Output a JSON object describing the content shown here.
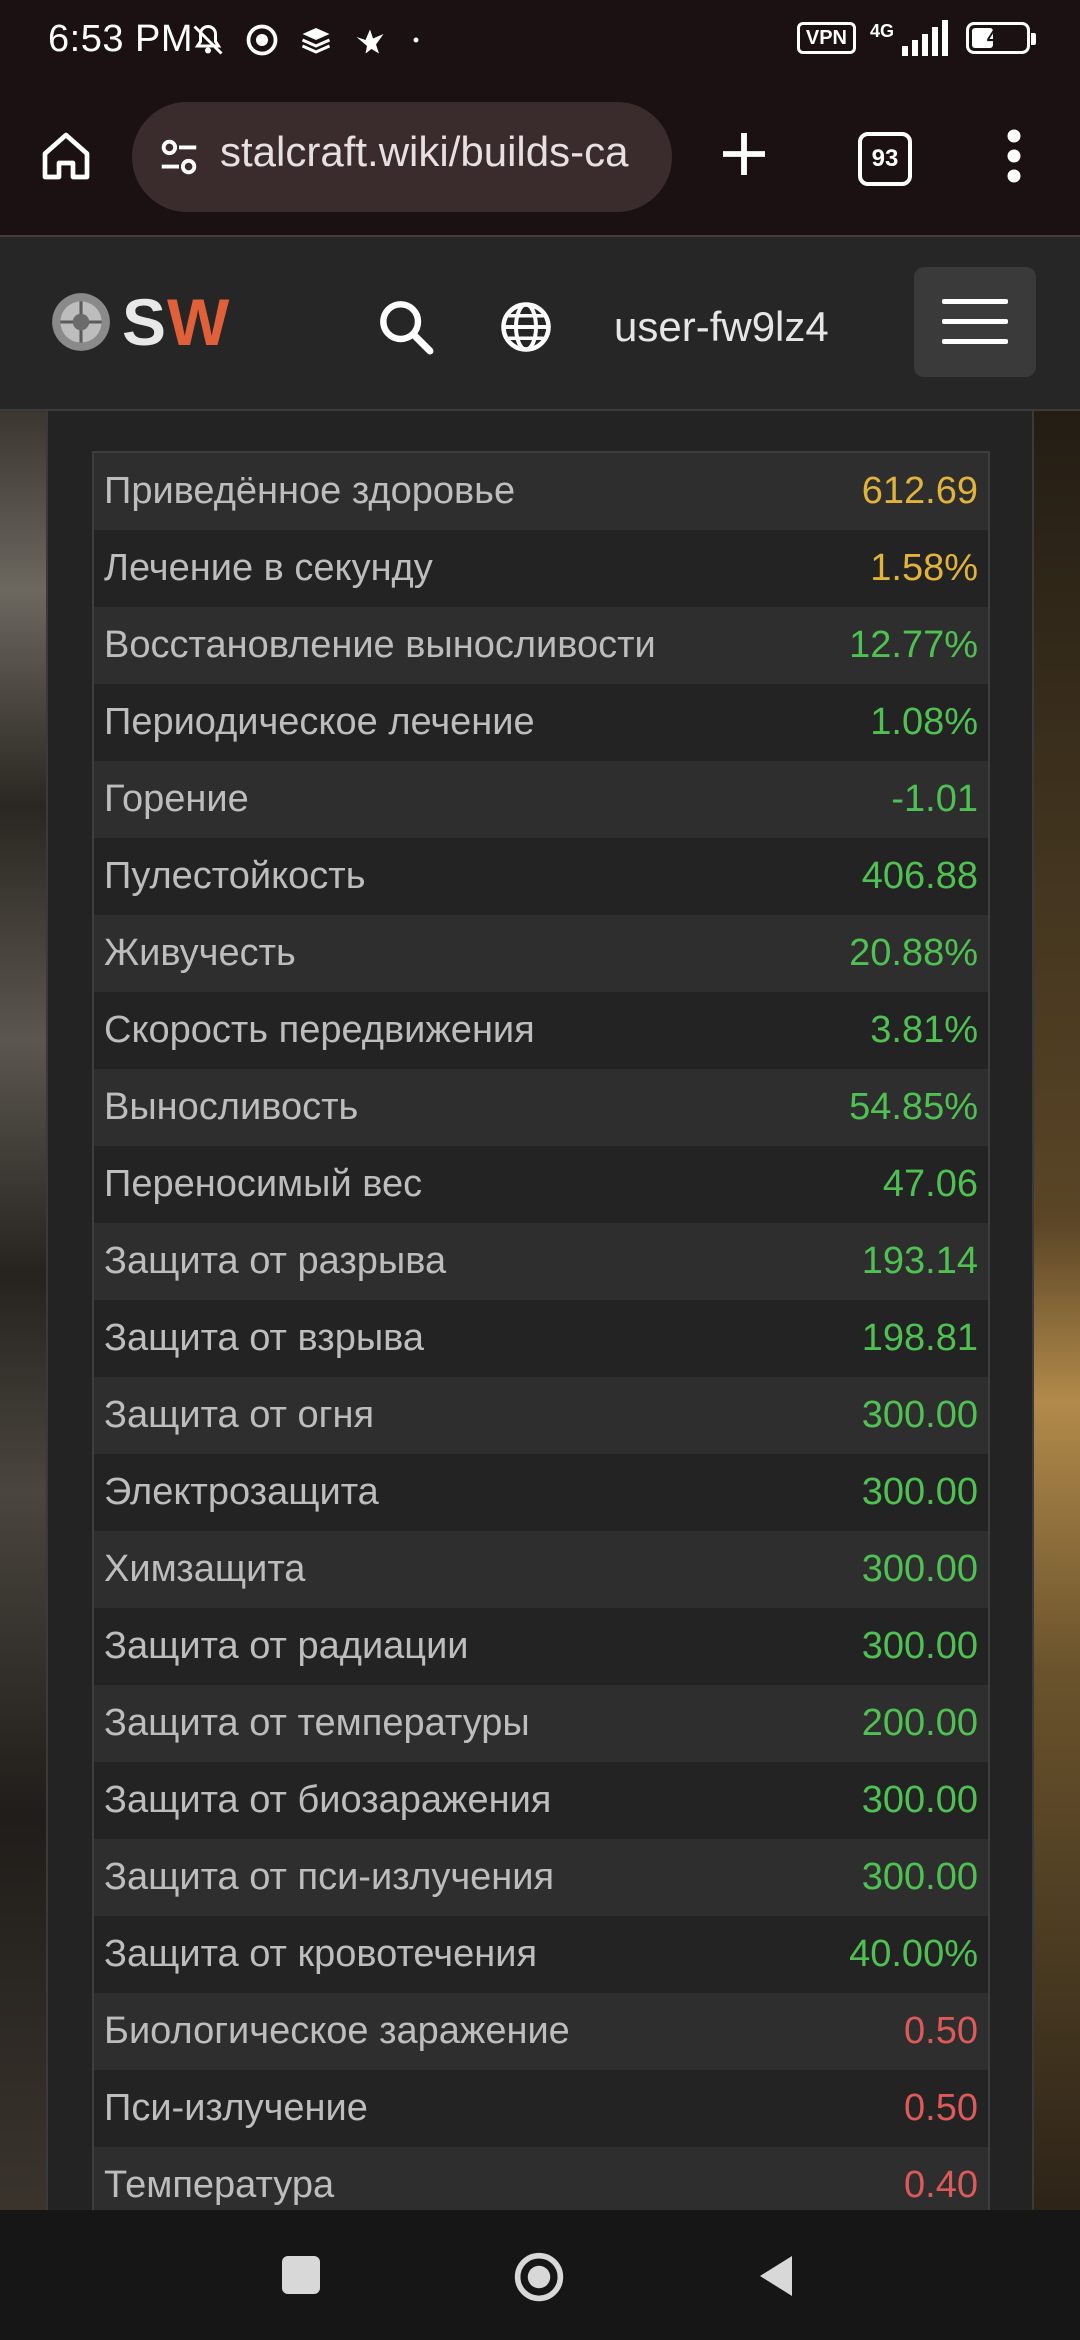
{
  "status_bar": {
    "time": "6:53 PM",
    "vpn_label": "VPN",
    "network_label": "4G",
    "battery_level": 47
  },
  "browser": {
    "url": "stalcraft.wiki/builds-ca",
    "tab_count": "93"
  },
  "site": {
    "logo_s": "S",
    "logo_w": "W",
    "username": "user-fw9lz4"
  },
  "colors": {
    "yellow": "#e2b33a",
    "green": "#4fc152",
    "red": "#dd5a5a"
  },
  "stats": [
    {
      "label": "Приведённое здоровье",
      "value": "612.69",
      "tone": "yellow"
    },
    {
      "label": "Лечение в секунду",
      "value": "1.58%",
      "tone": "yellow"
    },
    {
      "label": "Восстановление выносливости",
      "value": "12.77%",
      "tone": "green"
    },
    {
      "label": "Периодическое лечение",
      "value": "1.08%",
      "tone": "green"
    },
    {
      "label": "Горение",
      "value": "-1.01",
      "tone": "green"
    },
    {
      "label": "Пулестойкость",
      "value": "406.88",
      "tone": "green"
    },
    {
      "label": "Живучесть",
      "value": "20.88%",
      "tone": "green"
    },
    {
      "label": "Скорость передвижения",
      "value": "3.81%",
      "tone": "green"
    },
    {
      "label": "Выносливость",
      "value": "54.85%",
      "tone": "green"
    },
    {
      "label": "Переносимый вес",
      "value": "47.06",
      "tone": "green"
    },
    {
      "label": "Защита от разрыва",
      "value": "193.14",
      "tone": "green"
    },
    {
      "label": "Защита от взрыва",
      "value": "198.81",
      "tone": "green"
    },
    {
      "label": "Защита от огня",
      "value": "300.00",
      "tone": "green"
    },
    {
      "label": "Электрозащита",
      "value": "300.00",
      "tone": "green"
    },
    {
      "label": "Химзащита",
      "value": "300.00",
      "tone": "green"
    },
    {
      "label": "Защита от радиации",
      "value": "300.00",
      "tone": "green"
    },
    {
      "label": "Защита от температуры",
      "value": "200.00",
      "tone": "green"
    },
    {
      "label": "Защита от биозаражения",
      "value": "300.00",
      "tone": "green"
    },
    {
      "label": "Защита от пси-излучения",
      "value": "300.00",
      "tone": "green"
    },
    {
      "label": "Защита от кровотечения",
      "value": "40.00%",
      "tone": "green"
    },
    {
      "label": "Биологическое заражение",
      "value": "0.50",
      "tone": "red"
    },
    {
      "label": "Пси-излучение",
      "value": "0.50",
      "tone": "red"
    },
    {
      "label": "Температура",
      "value": "0.40",
      "tone": "red"
    }
  ]
}
